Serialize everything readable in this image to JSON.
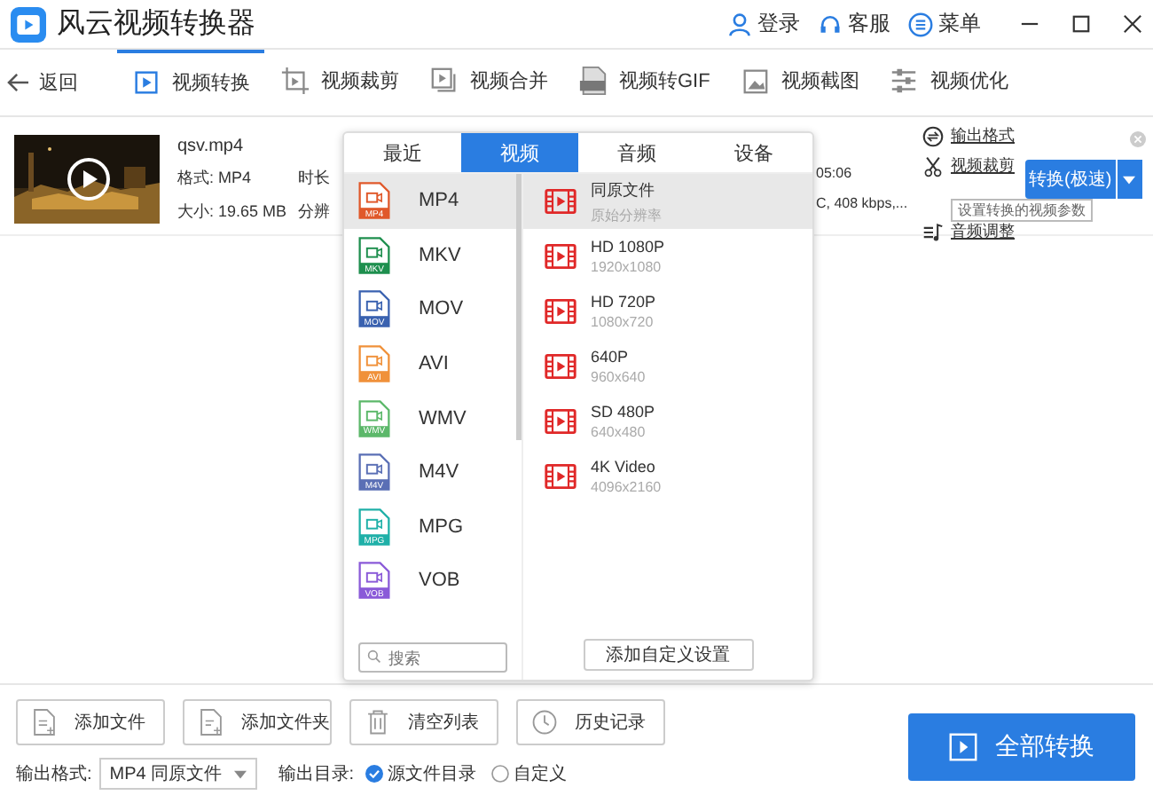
{
  "window": {
    "title": "风云视频转换器"
  },
  "header_actions": [
    {
      "kind": "user",
      "label": "登录"
    },
    {
      "kind": "headset",
      "label": "客服"
    },
    {
      "kind": "menu",
      "label": "菜单"
    }
  ],
  "back": {
    "label": "返回"
  },
  "tabs": [
    {
      "kind": "convert",
      "label": "视频转换",
      "selected": true
    },
    {
      "kind": "crop",
      "label": "视频裁剪",
      "selected": false
    },
    {
      "kind": "merge",
      "label": "视频合并",
      "selected": false
    },
    {
      "kind": "gif",
      "label": "视频转GIF",
      "selected": false
    },
    {
      "kind": "shot",
      "label": "视频截图",
      "selected": false
    },
    {
      "kind": "tune",
      "label": "视频优化",
      "selected": false
    }
  ],
  "file": {
    "name": "qsv.mp4",
    "format": "格式: MP4",
    "size": "大小: 19.65 MB",
    "duration_label": "时长",
    "resolution_label": "分辨",
    "duration_tail": "05:06",
    "info_tail": "C, 408 kbps,..."
  },
  "file_actions": [
    {
      "kind": "format",
      "label": "输出格式"
    },
    {
      "kind": "cut",
      "label": "视频裁剪"
    },
    {
      "kind": "audio",
      "label": "音频调整"
    }
  ],
  "tooltip": "设置转换的视频参数",
  "convert_button": "转换(极速)",
  "popup": {
    "tabs": [
      {
        "label": "最近",
        "selected": false
      },
      {
        "label": "视频",
        "selected": true
      },
      {
        "label": "音频",
        "selected": false
      },
      {
        "label": "设备",
        "selected": false
      }
    ],
    "formats": [
      {
        "label": "MP4",
        "badge": "MP4",
        "color": "#e0582a",
        "selected": true
      },
      {
        "label": "MKV",
        "badge": "MKV",
        "color": "#1e8f4e",
        "selected": false
      },
      {
        "label": "MOV",
        "badge": "MOV",
        "color": "#3a62b0",
        "selected": false
      },
      {
        "label": "AVI",
        "badge": "AVI",
        "color": "#f0913a",
        "selected": false
      },
      {
        "label": "WMV",
        "badge": "WMV",
        "color": "#5cb86a",
        "selected": false
      },
      {
        "label": "M4V",
        "badge": "M4V",
        "color": "#5a6fb5",
        "selected": false
      },
      {
        "label": "MPG",
        "badge": "MPG",
        "color": "#1fb0a8",
        "selected": false
      },
      {
        "label": "VOB",
        "badge": "VOB",
        "color": "#8a5ad8",
        "selected": false
      }
    ],
    "search_placeholder": "搜索",
    "presets": [
      {
        "name": "同原文件",
        "detail": "原始分辨率",
        "selected": true
      },
      {
        "name": "HD 1080P",
        "detail": "1920x1080",
        "selected": false
      },
      {
        "name": "HD 720P",
        "detail": "1080x720",
        "selected": false
      },
      {
        "name": "640P",
        "detail": "960x640",
        "selected": false
      },
      {
        "name": "SD 480P",
        "detail": "640x480",
        "selected": false
      },
      {
        "name": "4K Video",
        "detail": "4096x2160",
        "selected": false
      }
    ],
    "custom_button": "添加自定义设置"
  },
  "bottom_buttons": [
    {
      "kind": "file",
      "label": "添加文件"
    },
    {
      "kind": "folder",
      "label": "添加文件夹"
    },
    {
      "kind": "trash",
      "label": "清空列表"
    },
    {
      "kind": "clock",
      "label": "历史记录"
    }
  ],
  "output_format": {
    "label": "输出格式:",
    "value": "MP4 同原文件"
  },
  "output_dir": {
    "label": "输出目录:",
    "options": [
      {
        "label": "源文件目录",
        "selected": true
      },
      {
        "label": "自定义",
        "selected": false
      }
    ]
  },
  "convert_all": "全部转换"
}
